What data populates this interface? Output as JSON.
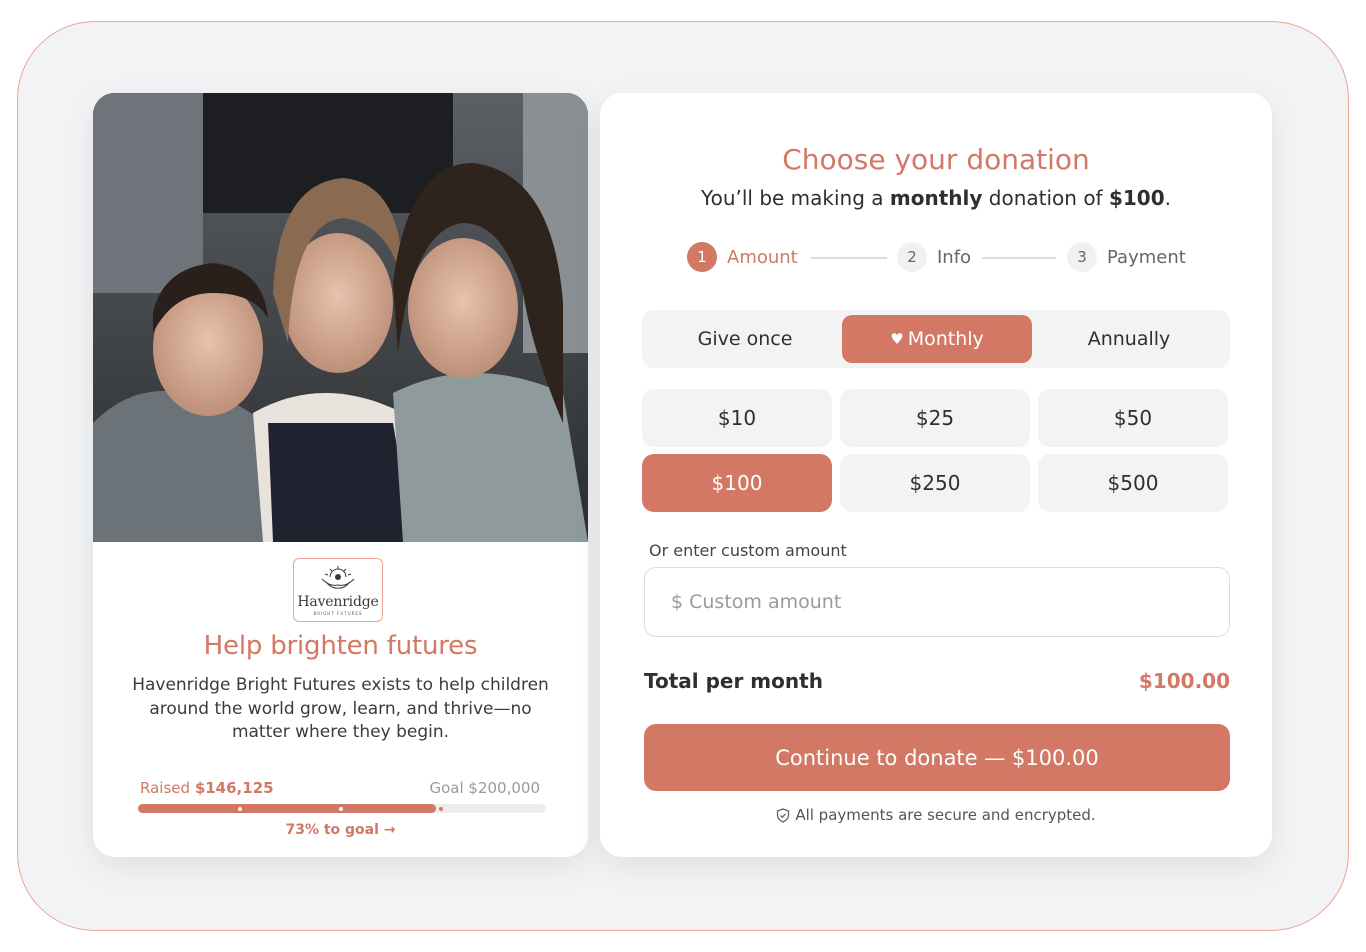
{
  "campaign": {
    "logo_name": "Havenridge",
    "logo_tagline": "BRIGHT FUTURES",
    "title": "Help brighten futures",
    "description": "Havenridge Bright Futures exists to help children around the world grow, learn, and thrive—no matter where they begin.",
    "raised_label": "Raised",
    "raised_value": "$146,125",
    "goal_label": "Goal",
    "goal_value": "$200,000",
    "progress_fraction": 0.73,
    "progress_text": "73% to goal →"
  },
  "form": {
    "title": "Choose your donation",
    "subtitle_prefix": "You’ll be making a",
    "subtitle_frequency": "monthly",
    "subtitle_middle": "donation of",
    "subtitle_amount": "$100",
    "subtitle_end": ".",
    "steps": [
      {
        "number": "1",
        "label": "Amount",
        "active": true
      },
      {
        "number": "2",
        "label": "Info",
        "active": false
      },
      {
        "number": "3",
        "label": "Payment",
        "active": false
      }
    ],
    "frequency": {
      "options": [
        "Give once",
        "Monthly",
        "Annually"
      ],
      "selected": "Monthly",
      "selected_icon": "heart-icon"
    },
    "amounts": [
      "$10",
      "$25",
      "$50",
      "$100",
      "$250",
      "$500"
    ],
    "selected_amount": "$100",
    "custom_label": "Or enter custom amount",
    "custom_placeholder": "$ Custom amount",
    "total_label": "Total per month",
    "total_value": "$100.00",
    "cta_label": "Continue to donate — $100.00",
    "secure_icon": "shield-check-icon",
    "secure_text": "All payments are secure and encrypted."
  },
  "colors": {
    "accent": "#d27864",
    "frame_border": "#e8a593",
    "surface": "#f3f3f3"
  }
}
